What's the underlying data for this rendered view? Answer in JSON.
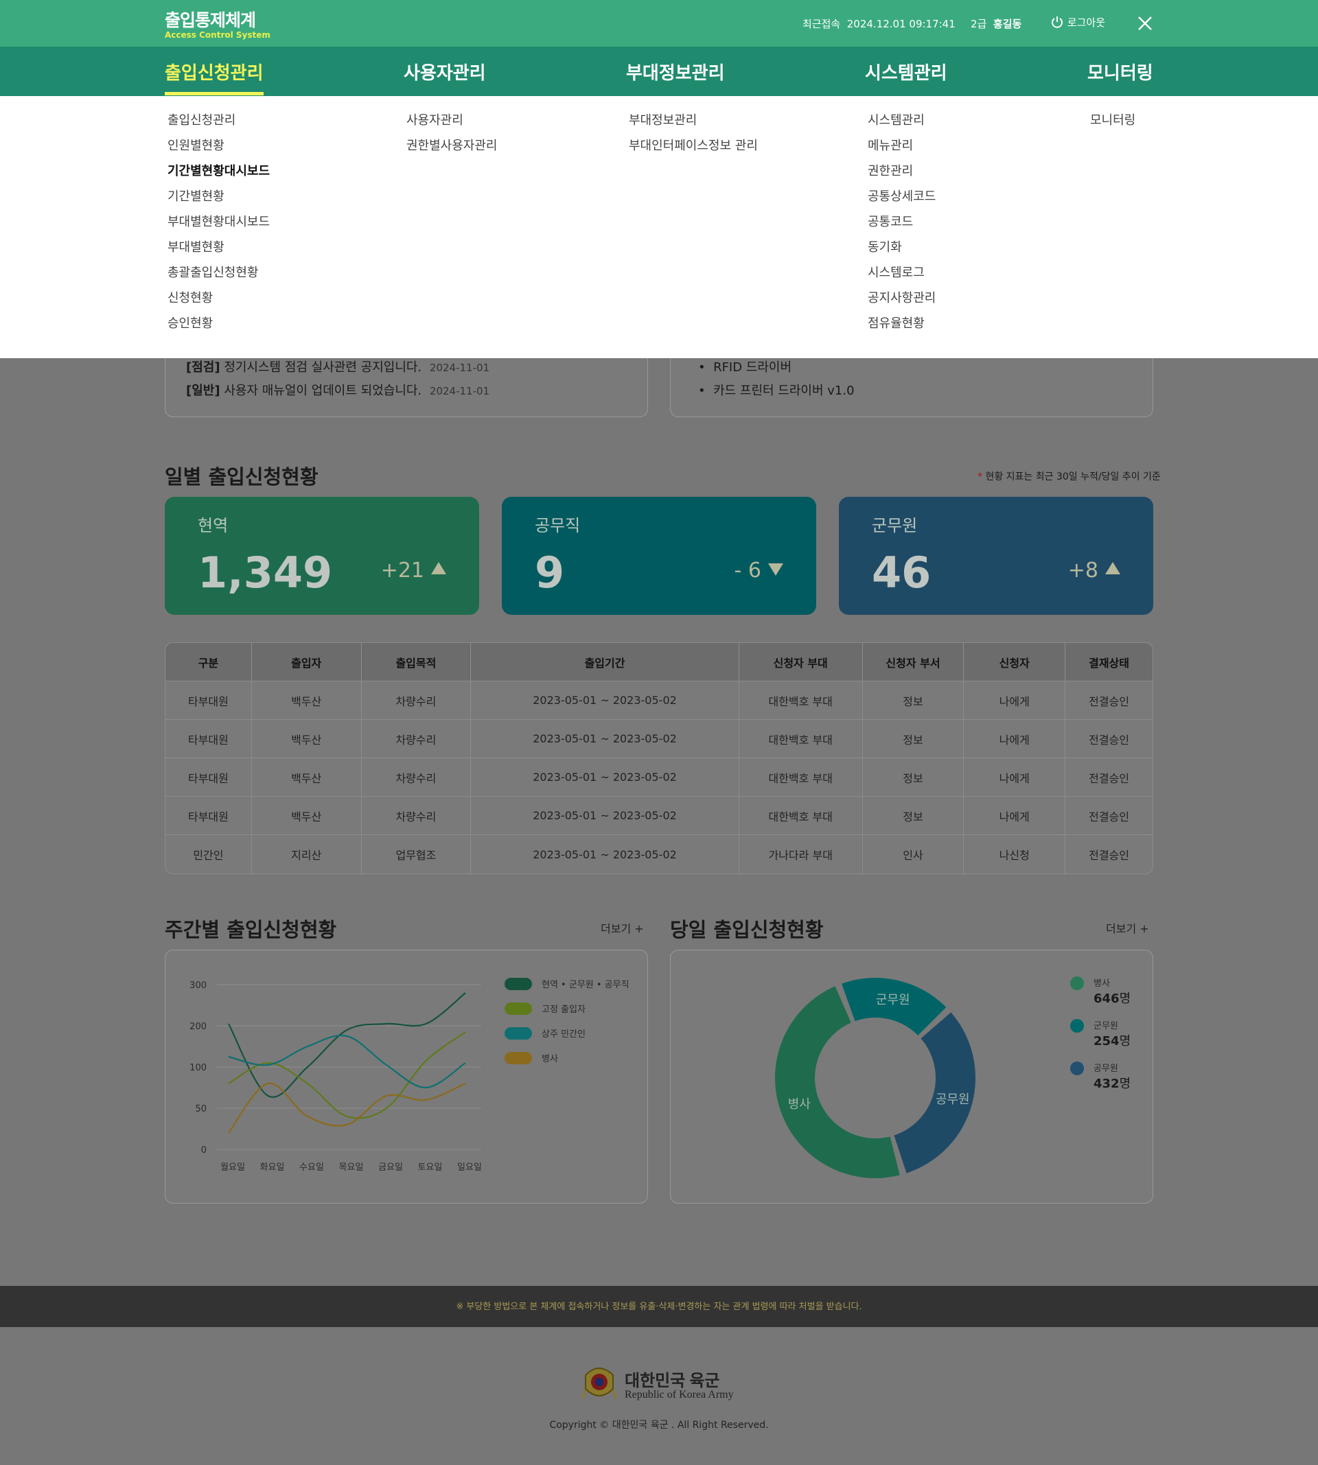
{
  "header": {
    "title": "출입통제체계",
    "subtitle": "Access Control System",
    "last_login_label": "최근접속",
    "last_login_value": "2024.12.01 09:17:41",
    "user_grade": "2급",
    "user_name": "홍길동",
    "logout_label": "로그아웃"
  },
  "gnb": [
    "출입신청관리",
    "사용자관리",
    "부대정보관리",
    "시스템관리",
    "모니터링"
  ],
  "menu": {
    "col1": [
      "출입신청관리",
      "인원별현황",
      "기간별현황대시보드",
      "기간별현황",
      "부대별현황대시보드",
      "부대별현황",
      "총괄출입신청현황",
      "신청현황",
      "승인현황"
    ],
    "col2": [
      "사용자관리",
      "권한별사용자관리"
    ],
    "col3": [
      "부대정보관리",
      "부대인터페이스정보 관리"
    ],
    "col4": [
      "시스템관리",
      "메뉴관리",
      "권한관리",
      "공통상세코드",
      "공통코드",
      "동기화",
      "시스템로그",
      "공지사항관리",
      "점유율현황"
    ],
    "col5": [
      "모니터링"
    ]
  },
  "notices": [
    {
      "tag": "[점검]",
      "text": "정기시스템 점검 실사관련 공지입니다.",
      "date": "2024-11-01"
    },
    {
      "tag": "[일반]",
      "text": "사용자 매뉴얼이 업데이트 되었습니다.",
      "date": "2024-11-01"
    }
  ],
  "downloads": [
    "RFID 드라이버",
    "카드 프린터 드라이버 v1.0"
  ],
  "daily": {
    "title": "일별 출입신청현황",
    "note_star": "*",
    "note": "현황 지표는 최근 30일 누적/당일 추이 기준",
    "cards": [
      {
        "label": "현역",
        "value": "1,349",
        "delta": "+21",
        "dir": "up",
        "color": "#1f6b4e"
      },
      {
        "label": "공무직",
        "value": "9",
        "delta": "- 6",
        "dir": "down",
        "color": "#005a5f"
      },
      {
        "label": "군무원",
        "value": "46",
        "delta": "+8",
        "dir": "up",
        "color": "#1f4a66"
      }
    ]
  },
  "table": {
    "headers": [
      "구분",
      "출입자",
      "출입목적",
      "출입기간",
      "신청자 부대",
      "신청자 부서",
      "신청자",
      "결재상태"
    ],
    "rows": [
      [
        "타부대원",
        "백두산",
        "차량수리",
        "2023-05-01  ~  2023-05-02",
        "대한백호 부대",
        "정보",
        "나에게",
        "전결승인"
      ],
      [
        "타부대원",
        "백두산",
        "차량수리",
        "2023-05-01  ~  2023-05-02",
        "대한백호 부대",
        "정보",
        "나에게",
        "전결승인"
      ],
      [
        "타부대원",
        "백두산",
        "차량수리",
        "2023-05-01  ~  2023-05-02",
        "대한백호 부대",
        "정보",
        "나에게",
        "전결승인"
      ],
      [
        "타부대원",
        "백두산",
        "차량수리",
        "2023-05-01  ~  2023-05-02",
        "대한백호 부대",
        "정보",
        "나에게",
        "전결승인"
      ],
      [
        "민간인",
        "지리산",
        "업무협조",
        "2023-05-01  ~  2023-05-02",
        "가나다라 부대",
        "인사",
        "나신청",
        "전결승인"
      ]
    ]
  },
  "weekly": {
    "title": "주간별 출입신청현황",
    "more": "더보기 +"
  },
  "today": {
    "title": "당일 출입신청현황",
    "more": "더보기 +"
  },
  "chart_data": [
    {
      "type": "line",
      "x": [
        "월요일",
        "화요일",
        "수요일",
        "목요일",
        "금요일",
        "토요일",
        "일요일"
      ],
      "y_ticks": [
        "300",
        "200",
        "100",
        "50",
        "0"
      ],
      "series": [
        {
          "name": "현역 • 군무원 • 공무직",
          "color": "#15533c",
          "values": [
            205,
            65,
            100,
            190,
            205,
            205,
            280
          ]
        },
        {
          "name": "고정 출입자",
          "color": "#5f7a1a",
          "values": [
            80,
            110,
            80,
            40,
            50,
            115,
            185
          ]
        },
        {
          "name": "상주 민간인",
          "color": "#0f6f72",
          "values": [
            125,
            105,
            150,
            175,
            105,
            75,
            110
          ]
        },
        {
          "name": "병사",
          "color": "#8a6a1c",
          "values": [
            20,
            80,
            40,
            30,
            65,
            60,
            80
          ]
        }
      ]
    },
    {
      "type": "pie",
      "slices": [
        {
          "label": "병사",
          "value": 646,
          "color": "#1f6b4e"
        },
        {
          "label": "군무원",
          "value": 254,
          "color": "#006466"
        },
        {
          "label": "공무원",
          "value": 432,
          "color": "#1f4a66"
        }
      ],
      "legend": [
        {
          "label": "병사",
          "value": "646",
          "unit": "명",
          "color": "#2a7a58"
        },
        {
          "label": "군무원",
          "value": "254",
          "unit": "명",
          "color": "#00696b"
        },
        {
          "label": "공무원",
          "value": "432",
          "unit": "명",
          "color": "#234f70"
        }
      ]
    }
  ],
  "footer": {
    "warning": "※ 부당한 방법으로 본 체계에 접속하거나 정보를 유출·삭제·변경하는 자는 관계 법령에 따라 처벌을 받습니다.",
    "org_ko": "대한민국 육군",
    "org_en": "Republic of Korea Army",
    "copyright": "Copyright © 대한민국 육군 . All Right Reserved."
  }
}
